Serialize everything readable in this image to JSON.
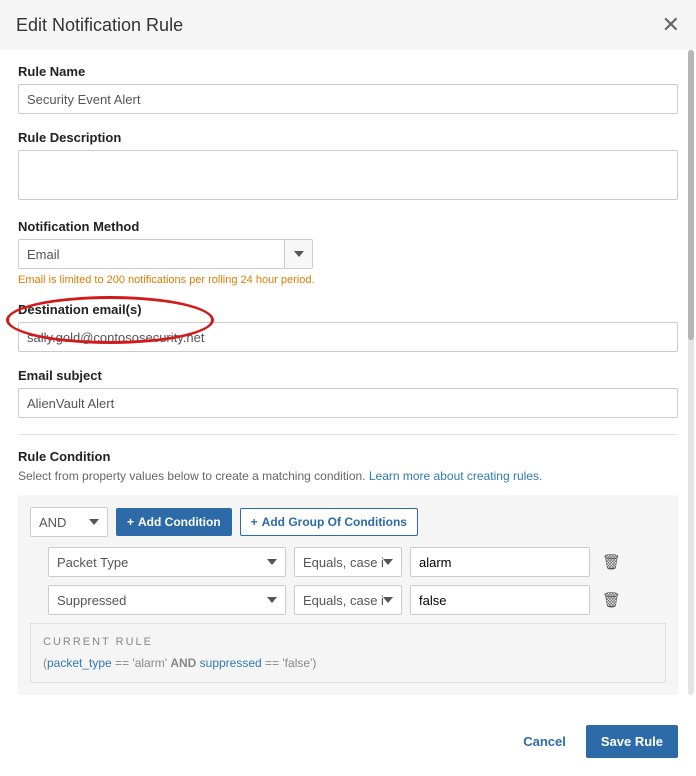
{
  "header": {
    "title": "Edit Notification Rule"
  },
  "form": {
    "ruleName": {
      "label": "Rule Name",
      "value": "Security Event Alert"
    },
    "ruleDescription": {
      "label": "Rule Description",
      "value": ""
    },
    "notificationMethod": {
      "label": "Notification Method",
      "value": "Email",
      "helper": "Email is limited to 200 notifications per rolling 24 hour period."
    },
    "destinationEmails": {
      "label": "Destination email(s)",
      "value": "sally.gold@contososecurity.net"
    },
    "emailSubject": {
      "label": "Email subject",
      "value": "AlienVault Alert"
    }
  },
  "ruleCondition": {
    "label": "Rule Condition",
    "subtext": "Select from property values below to create a matching condition. ",
    "learnLink": "Learn more about creating rules.",
    "logicOperator": "AND",
    "addConditionLabel": "Add Condition",
    "addGroupLabel": "Add Group Of Conditions",
    "rows": [
      {
        "property": "Packet Type",
        "operator": "Equals, case insensitive",
        "value": "alarm"
      },
      {
        "property": "Suppressed",
        "operator": "Equals, case insensitive",
        "value": "false"
      }
    ],
    "currentRule": {
      "title": "CURRENT RULE",
      "field1": "packet_type",
      "eq1": " == ",
      "val1": "'alarm' ",
      "and": "AND",
      "field2": " suppressed",
      "eq2": " == ",
      "val2": "'false'"
    }
  },
  "footer": {
    "cancel": "Cancel",
    "save": "Save Rule"
  }
}
